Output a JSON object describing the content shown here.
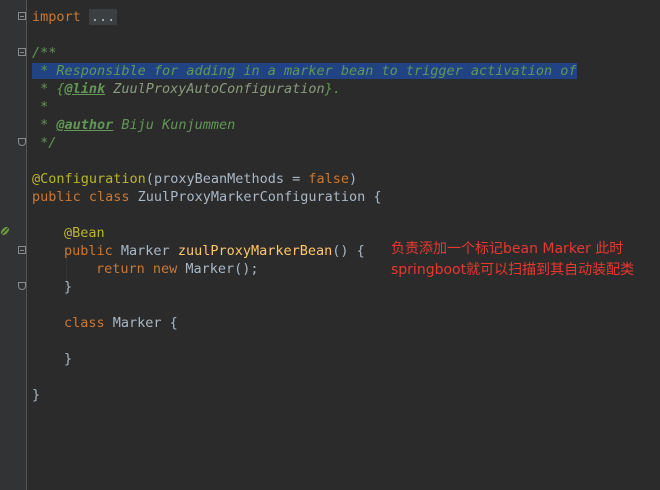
{
  "editor": {
    "lines": {
      "import_kw": "import",
      "import_fold": "...",
      "doc_open": "/**",
      "doc_line1": " * Responsible for adding in a marker bean to trigger activation of",
      "doc_line2_prefix": " * {",
      "doc_line2_tag": "@link",
      "doc_line2_ref": " ZuulProxyAutoConfiguration",
      "doc_line2_suffix": "}.",
      "doc_line3": " *",
      "doc_line4_prefix": " * ",
      "doc_line4_tag": "@author",
      "doc_line4_text": " Biju Kunjummen",
      "doc_close": " */",
      "config_ann": "@Configuration",
      "config_open": "(",
      "config_param": "proxyBeanMethods = ",
      "config_value": "false",
      "config_close": ")",
      "class_kw": "public class ",
      "class_name": "ZuulProxyMarkerConfiguration {",
      "bean_ann": "@Bean",
      "method_kw": "public ",
      "method_type": "Marker ",
      "method_name": "zuulProxyMarkerBean",
      "method_rest": "() {",
      "return_kw": "return new ",
      "return_rest": "Marker();",
      "method_close": "}",
      "marker_kw": "class ",
      "marker_name": "Marker {",
      "marker_close": "}",
      "class_close": "}"
    },
    "colors": {
      "background": "#2b2b2b",
      "keyword": "#cc7832",
      "annotation": "#bbb529",
      "comment": "#629755",
      "function": "#ffc66d",
      "selection": "#214283",
      "note": "#e8382f"
    }
  },
  "annotation_note": {
    "line1": "负责添加一个标记bean Marker 此时",
    "line2": "springboot就可以扫描到其自动装配类"
  },
  "icons": [
    "fold-icon",
    "spring-bean-gutter-icon"
  ]
}
